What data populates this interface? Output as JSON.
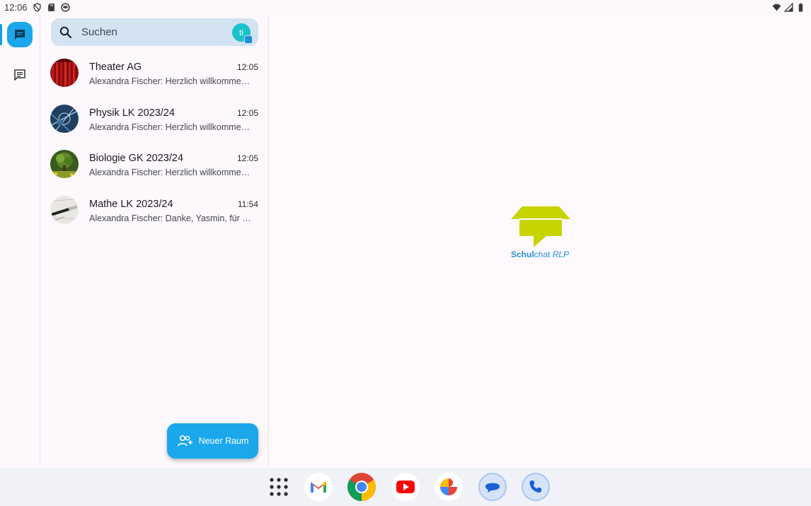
{
  "statusbar": {
    "time": "12:06"
  },
  "rail": {
    "items": [
      {
        "name": "chats",
        "icon": "chat-bubble-icon",
        "active": true
      },
      {
        "name": "spaces",
        "icon": "message-icon",
        "active": false
      }
    ]
  },
  "search": {
    "placeholder": "Suchen",
    "avatar_initials": "ti"
  },
  "chats": [
    {
      "title": "Theater AG",
      "time": "12:05",
      "preview": "Alexandra Fischer: Herzlich willkommen in der Theater AG!",
      "avatar": "theater-curtain"
    },
    {
      "title": "Physik LK 2023/24",
      "time": "12:05",
      "preview": "Alexandra Fischer: Herzlich willkommen im Physik LK!",
      "avatar": "physics"
    },
    {
      "title": "Biologie GK 2023/24",
      "time": "12:05",
      "preview": "Alexandra Fischer: Herzlich willkommen im Biologie GK!",
      "avatar": "tree"
    },
    {
      "title": "Mathe LK 2023/24",
      "time": "11:54",
      "preview": "Alexandra Fischer: Danke, Yasmin, für die Lösungen!",
      "avatar": "pen"
    }
  ],
  "fab": {
    "label": "Neuer Raum"
  },
  "logo": {
    "brand_bold": "Schul",
    "brand_regular": "chat",
    "brand_italic": " RLP"
  },
  "dock": {
    "apps": [
      "app-drawer",
      "gmail",
      "chrome",
      "youtube",
      "photos",
      "messages",
      "phone"
    ]
  },
  "colors": {
    "accent": "#1aa7ec",
    "search_bg": "#d3e3f1",
    "logo_green": "#c8d400",
    "logo_blue": "#2a8fd1"
  }
}
